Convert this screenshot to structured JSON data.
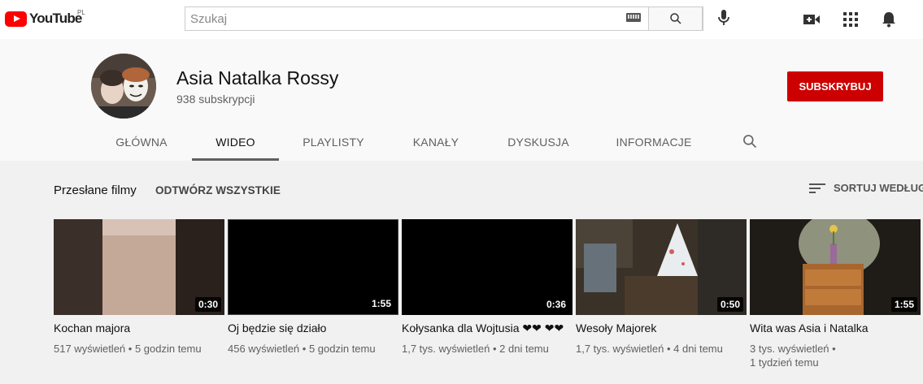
{
  "topbar": {
    "logo_text": "YouTube",
    "logo_country": "PL",
    "search_placeholder": "Szukaj",
    "icons": [
      "keyboard-icon",
      "search-icon",
      "mic-icon",
      "create-video-icon",
      "apps-icon",
      "notifications-icon"
    ]
  },
  "channel": {
    "name": "Asia Natalka Rossy",
    "subscribers": "938 subskrypcji",
    "subscribe_label": "SUBSKRYBUJ",
    "subscribe_color": "#cc0000"
  },
  "tabs": [
    {
      "label": "GŁÓWNA",
      "active": false
    },
    {
      "label": "WIDEO",
      "active": true
    },
    {
      "label": "PLAYLISTY",
      "active": false
    },
    {
      "label": "KANAŁY",
      "active": false
    },
    {
      "label": "DYSKUSJA",
      "active": false
    },
    {
      "label": "INFORMACJE",
      "active": false
    }
  ],
  "section": {
    "title": "Przesłane filmy",
    "play_all": "ODTWÓRZ WSZYSTKIE",
    "sort_label": "SORTUJ WEDŁUG"
  },
  "videos": [
    {
      "title": "Kochan majora",
      "duration": "0:30",
      "views": "517 wyświetleń",
      "age": "5 godzin temu"
    },
    {
      "title": "Oj będzie się działo",
      "duration": "1:55",
      "views": "456 wyświetleń",
      "age": "5 godzin temu"
    },
    {
      "title": "Kołysanka dla Wojtusia ❤❤ ❤❤",
      "duration": "0:36",
      "views": "1,7 tys. wyświetleń",
      "age": "2 dni temu"
    },
    {
      "title": "Wesoły Majorek",
      "duration": "0:50",
      "views": "1,7 tys. wyświetleń",
      "age": "4 dni temu"
    },
    {
      "title": "Wita was Asia i Natalka",
      "duration": "1:55",
      "views": "3 tys. wyświetleń",
      "age": "1 tydzień temu"
    }
  ]
}
